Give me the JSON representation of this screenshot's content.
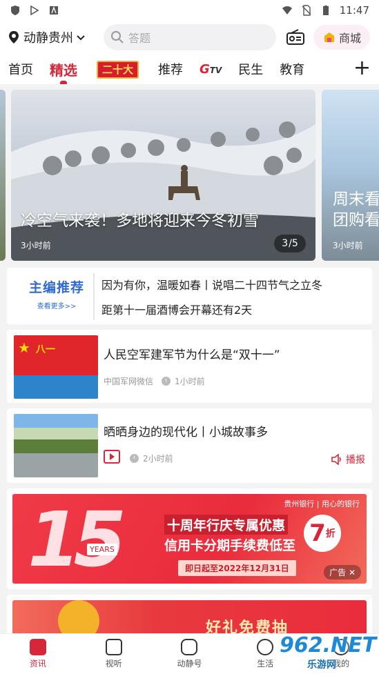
{
  "status_bar": {
    "time": "11:47"
  },
  "header": {
    "location": "动静贵州",
    "search_placeholder": "答题",
    "shop_label": "商城"
  },
  "tabs": [
    {
      "label": "首页"
    },
    {
      "label": "精选",
      "active": true
    },
    {
      "label": "二十大",
      "badge": true
    },
    {
      "label": "推荐"
    },
    {
      "label": "G",
      "sub": "TV"
    },
    {
      "label": "民生"
    },
    {
      "label": "教育"
    }
  ],
  "carousel": {
    "main": {
      "title": "冷空气来袭！多地将迎来今冬初雪",
      "time": "3小时前",
      "counter_current": "3",
      "counter_total": "/5"
    },
    "right": {
      "title": "周末看",
      "title2": "团购看",
      "time": "3小时前"
    }
  },
  "editor_pick": {
    "logo_title": "主编推荐",
    "logo_sub": "查看更多>>",
    "lines": [
      "因为有你，温暖如春丨说唱二十四节气之立冬",
      "距第十一届酒博会开幕还有2天"
    ]
  },
  "news": [
    {
      "title": "人民空军建军节为什么是“双十一”",
      "source": "中国军网微信",
      "time": "1小时前",
      "thumb_text": "八一"
    },
    {
      "title": "晒晒身边的现代化丨小城故事多",
      "time": "2小时前",
      "action": "播报"
    }
  ],
  "ad": {
    "number": "15",
    "years": "YEARS",
    "bank": "贵州银行 | 用心的银行",
    "headline": "十周年行庆专属优惠",
    "subline": "信用卡分期手续费低至",
    "discount": "7",
    "discount_unit": "折",
    "date": "即日起至2022年12月31日",
    "tag": "广告 ✕"
  },
  "ad2": {
    "text": "好礼免费抽"
  },
  "bottom_nav": [
    {
      "label": "资讯",
      "active": true
    },
    {
      "label": "视听"
    },
    {
      "label": "动静号"
    },
    {
      "label": "生活"
    },
    {
      "label": "我的"
    }
  ],
  "watermark": {
    "main": "962.NET",
    "sub": "乐游网"
  },
  "colors": {
    "accent": "#d6263a",
    "background": "#f3f3f3"
  }
}
